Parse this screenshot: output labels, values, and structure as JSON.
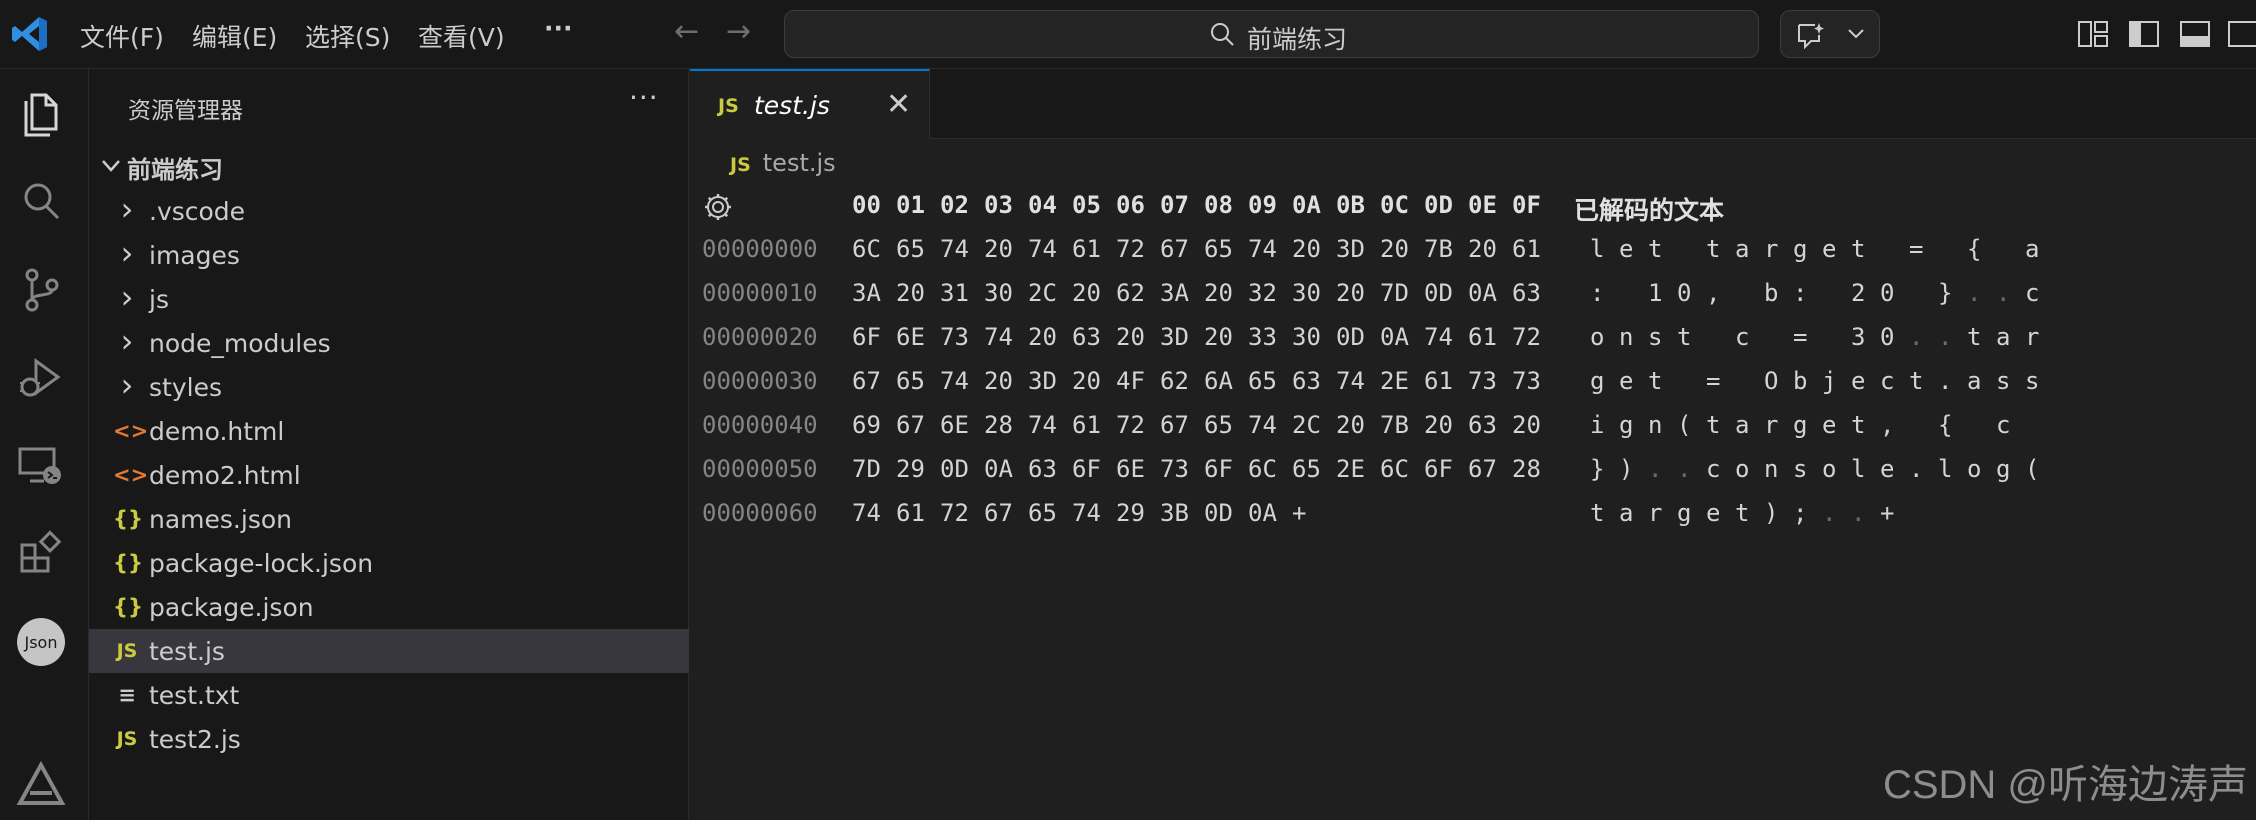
{
  "menu": {
    "file": "文件(F)",
    "edit": "编辑(E)",
    "selection": "选择(S)",
    "view": "查看(V)",
    "more": "···"
  },
  "search": {
    "text": "前端练习"
  },
  "sidebar": {
    "title": "资源管理器",
    "more": "···",
    "root_folder": "前端练习",
    "items": [
      {
        "name": ".vscode",
        "icon": "chevron-right-icon",
        "glyph": "›"
      },
      {
        "name": "images",
        "icon": "chevron-right-icon",
        "glyph": "›"
      },
      {
        "name": "js",
        "icon": "chevron-right-icon",
        "glyph": "›"
      },
      {
        "name": "node_modules",
        "icon": "chevron-right-icon",
        "glyph": "›"
      },
      {
        "name": "styles",
        "icon": "chevron-right-icon",
        "glyph": "›"
      },
      {
        "name": "demo.html",
        "icon": "html-file-icon",
        "glyph": "<>"
      },
      {
        "name": "demo2.html",
        "icon": "html-file-icon",
        "glyph": "<>"
      },
      {
        "name": "names.json",
        "icon": "json-file-icon",
        "glyph": "{}"
      },
      {
        "name": "package-lock.json",
        "icon": "json-file-icon",
        "glyph": "{}"
      },
      {
        "name": "package.json",
        "icon": "json-file-icon",
        "glyph": "{}"
      },
      {
        "name": "test.js",
        "icon": "js-file-icon",
        "glyph": "JS",
        "selected": true
      },
      {
        "name": "test.txt",
        "icon": "text-file-icon",
        "glyph": "≡"
      },
      {
        "name": "test2.js",
        "icon": "js-file-icon",
        "glyph": "JS"
      }
    ]
  },
  "editor": {
    "tab_label": "test.js",
    "tab_badge": "JS",
    "tab_close": "✕",
    "breadcrumb_badge": "JS",
    "breadcrumb": "test.js",
    "hex_header": [
      "00",
      "01",
      "02",
      "03",
      "04",
      "05",
      "06",
      "07",
      "08",
      "09",
      "0A",
      "0B",
      "0C",
      "0D",
      "0E",
      "0F"
    ],
    "decoded_title": "已解码的文本",
    "rows": [
      {
        "addr": "00000000",
        "bytes": [
          "6C",
          "65",
          "74",
          "20",
          "74",
          "61",
          "72",
          "67",
          "65",
          "74",
          "20",
          "3D",
          "20",
          "7B",
          "20",
          "61"
        ],
        "text": [
          "l",
          "e",
          "t",
          " ",
          "t",
          "a",
          "r",
          "g",
          "e",
          "t",
          " ",
          "=",
          " ",
          "{",
          " ",
          "a"
        ]
      },
      {
        "addr": "00000010",
        "bytes": [
          "3A",
          "20",
          "31",
          "30",
          "2C",
          "20",
          "62",
          "3A",
          "20",
          "32",
          "30",
          "20",
          "7D",
          "0D",
          "0A",
          "63"
        ],
        "text": [
          ":",
          " ",
          "1",
          "0",
          ",",
          " ",
          "b",
          ":",
          " ",
          "2",
          "0",
          " ",
          "}",
          ".",
          ".",
          "c"
        ]
      },
      {
        "addr": "00000020",
        "bytes": [
          "6F",
          "6E",
          "73",
          "74",
          "20",
          "63",
          "20",
          "3D",
          "20",
          "33",
          "30",
          "0D",
          "0A",
          "74",
          "61",
          "72"
        ],
        "text": [
          "o",
          "n",
          "s",
          "t",
          " ",
          "c",
          " ",
          "=",
          " ",
          "3",
          "0",
          ".",
          ".",
          "t",
          "a",
          "r"
        ]
      },
      {
        "addr": "00000030",
        "bytes": [
          "67",
          "65",
          "74",
          "20",
          "3D",
          "20",
          "4F",
          "62",
          "6A",
          "65",
          "63",
          "74",
          "2E",
          "61",
          "73",
          "73"
        ],
        "text": [
          "g",
          "e",
          "t",
          " ",
          "=",
          " ",
          "O",
          "b",
          "j",
          "e",
          "c",
          "t",
          ".",
          "a",
          "s",
          "s"
        ]
      },
      {
        "addr": "00000040",
        "bytes": [
          "69",
          "67",
          "6E",
          "28",
          "74",
          "61",
          "72",
          "67",
          "65",
          "74",
          "2C",
          "20",
          "7B",
          "20",
          "63",
          "20"
        ],
        "text": [
          "i",
          "g",
          "n",
          "(",
          "t",
          "a",
          "r",
          "g",
          "e",
          "t",
          ",",
          " ",
          "{",
          " ",
          "c",
          " "
        ]
      },
      {
        "addr": "00000050",
        "bytes": [
          "7D",
          "29",
          "0D",
          "0A",
          "63",
          "6F",
          "6E",
          "73",
          "6F",
          "6C",
          "65",
          "2E",
          "6C",
          "6F",
          "67",
          "28"
        ],
        "text": [
          "}",
          ")",
          ".",
          ".",
          "c",
          "o",
          "n",
          "s",
          "o",
          "l",
          "e",
          ".",
          "l",
          "o",
          "g",
          "("
        ]
      },
      {
        "addr": "00000060",
        "bytes": [
          "74",
          "61",
          "72",
          "67",
          "65",
          "74",
          "29",
          "3B",
          "0D",
          "0A",
          "+"
        ],
        "text": [
          "t",
          "a",
          "r",
          "g",
          "e",
          "t",
          ")",
          ";",
          ".",
          ".",
          "+"
        ]
      }
    ],
    "control_positions": [
      [
        1,
        13
      ],
      [
        1,
        14
      ],
      [
        2,
        11
      ],
      [
        2,
        12
      ],
      [
        5,
        2
      ],
      [
        5,
        3
      ],
      [
        6,
        8
      ],
      [
        6,
        9
      ]
    ]
  },
  "watermark": "CSDN @听海边涛声",
  "colors": {
    "accent": "#0078d4",
    "js_icon": "#cbcb41",
    "html_icon": "#e37933",
    "background": "#1f1f1f",
    "sidebar": "#181818"
  }
}
